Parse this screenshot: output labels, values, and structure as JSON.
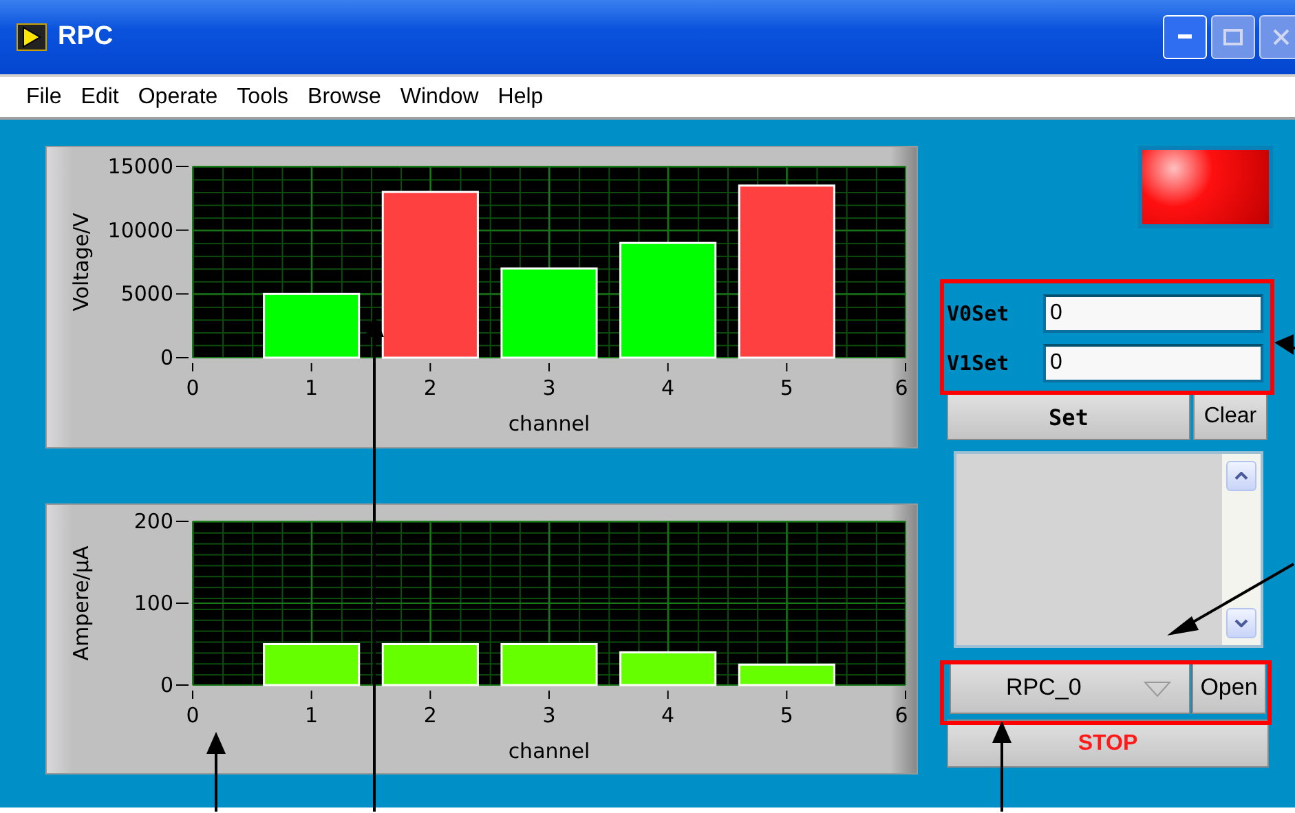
{
  "window": {
    "title": "RPC"
  },
  "menu": [
    "File",
    "Edit",
    "Operate",
    "Tools",
    "Browse",
    "Window",
    "Help"
  ],
  "charts": [
    {
      "chart_data": {
        "type": "bar",
        "xlabel": "channel",
        "ylabel": "Voltage/V",
        "x": [
          1,
          2,
          3,
          4,
          5
        ],
        "xlim": [
          0,
          6
        ],
        "ylim": [
          0,
          15000
        ],
        "xticks": [
          0,
          1,
          2,
          3,
          4,
          5,
          6
        ],
        "yticks": [
          0,
          5000,
          10000,
          15000
        ],
        "grid": true,
        "series": [
          {
            "color": "#00ff00",
            "values": [
              5000,
              null,
              7000,
              9000,
              null
            ]
          },
          {
            "color": "#ff4040",
            "values": [
              null,
              13000,
              null,
              null,
              13500
            ]
          }
        ]
      }
    },
    {
      "chart_data": {
        "type": "bar",
        "xlabel": "channel",
        "ylabel": "Ampere/μA",
        "x": [
          1,
          2,
          3,
          4,
          5
        ],
        "xlim": [
          0,
          6
        ],
        "ylim": [
          0,
          200
        ],
        "xticks": [
          0,
          1,
          2,
          3,
          4,
          5,
          6
        ],
        "yticks": [
          0,
          100,
          200
        ],
        "grid": true,
        "series": [
          {
            "color": "#66ff00",
            "values": [
              50,
              50,
              50,
              40,
              25
            ]
          }
        ]
      }
    }
  ],
  "indicator": {
    "on": true
  },
  "fields": [
    {
      "label": "V0Set",
      "value": "0"
    },
    {
      "label": "V1Set",
      "value": "0"
    }
  ],
  "set_button": "Set",
  "clear_button": "Clear",
  "device": {
    "value": "RPC_0"
  },
  "open_button": "Open",
  "stop_button": "STOP"
}
